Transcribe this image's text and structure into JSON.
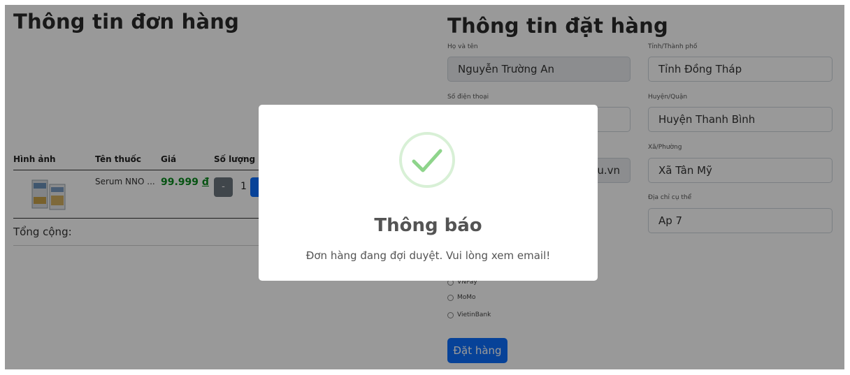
{
  "order_info": {
    "title": "Thông tin đơn hàng",
    "table": {
      "headers": [
        "Hình ảnh",
        "Tên thuốc",
        "Giá",
        "Số lượng"
      ],
      "rows": [
        {
          "image_icon": "product-box-image",
          "name": "Serum NNO ...",
          "price_amount": "99.999",
          "price_currency": "đ",
          "qty_minus": "-",
          "quantity": "1"
        }
      ]
    },
    "total_label": "Tổng cộng:"
  },
  "checkout": {
    "title": "Thông tin đặt hàng",
    "fields": {
      "name_label": "Họ và tên",
      "name_value": "Nguyễn Trường An",
      "phone_label": "Số điện thoại",
      "email_value_fragment": "u.vn",
      "city_label": "Tỉnh/Thành phố",
      "city_value": "Tỉnh Đồng Tháp",
      "district_label": "Huyện/Quận",
      "district_value": "Huyện Thanh Bình",
      "ward_label": "Xã/Phường",
      "ward_value": "Xã Tân Mỹ",
      "address_label": "Địa chỉ cụ thể",
      "address_value": "Ap 7"
    },
    "payment_options": [
      "VNPay",
      "MoMo",
      "VietinBank"
    ],
    "submit_label": "Đặt hàng"
  },
  "modal": {
    "icon": "success-check-icon",
    "title": "Thông báo",
    "message": "Đơn hàng đang đợi duyệt. Vui lòng xem email!"
  },
  "colors": {
    "primary": "#0d6efd",
    "price_green": "#0a8a1f",
    "success_check": "#8ed48b",
    "overlay": "rgba(0,0,0,0.40)"
  }
}
